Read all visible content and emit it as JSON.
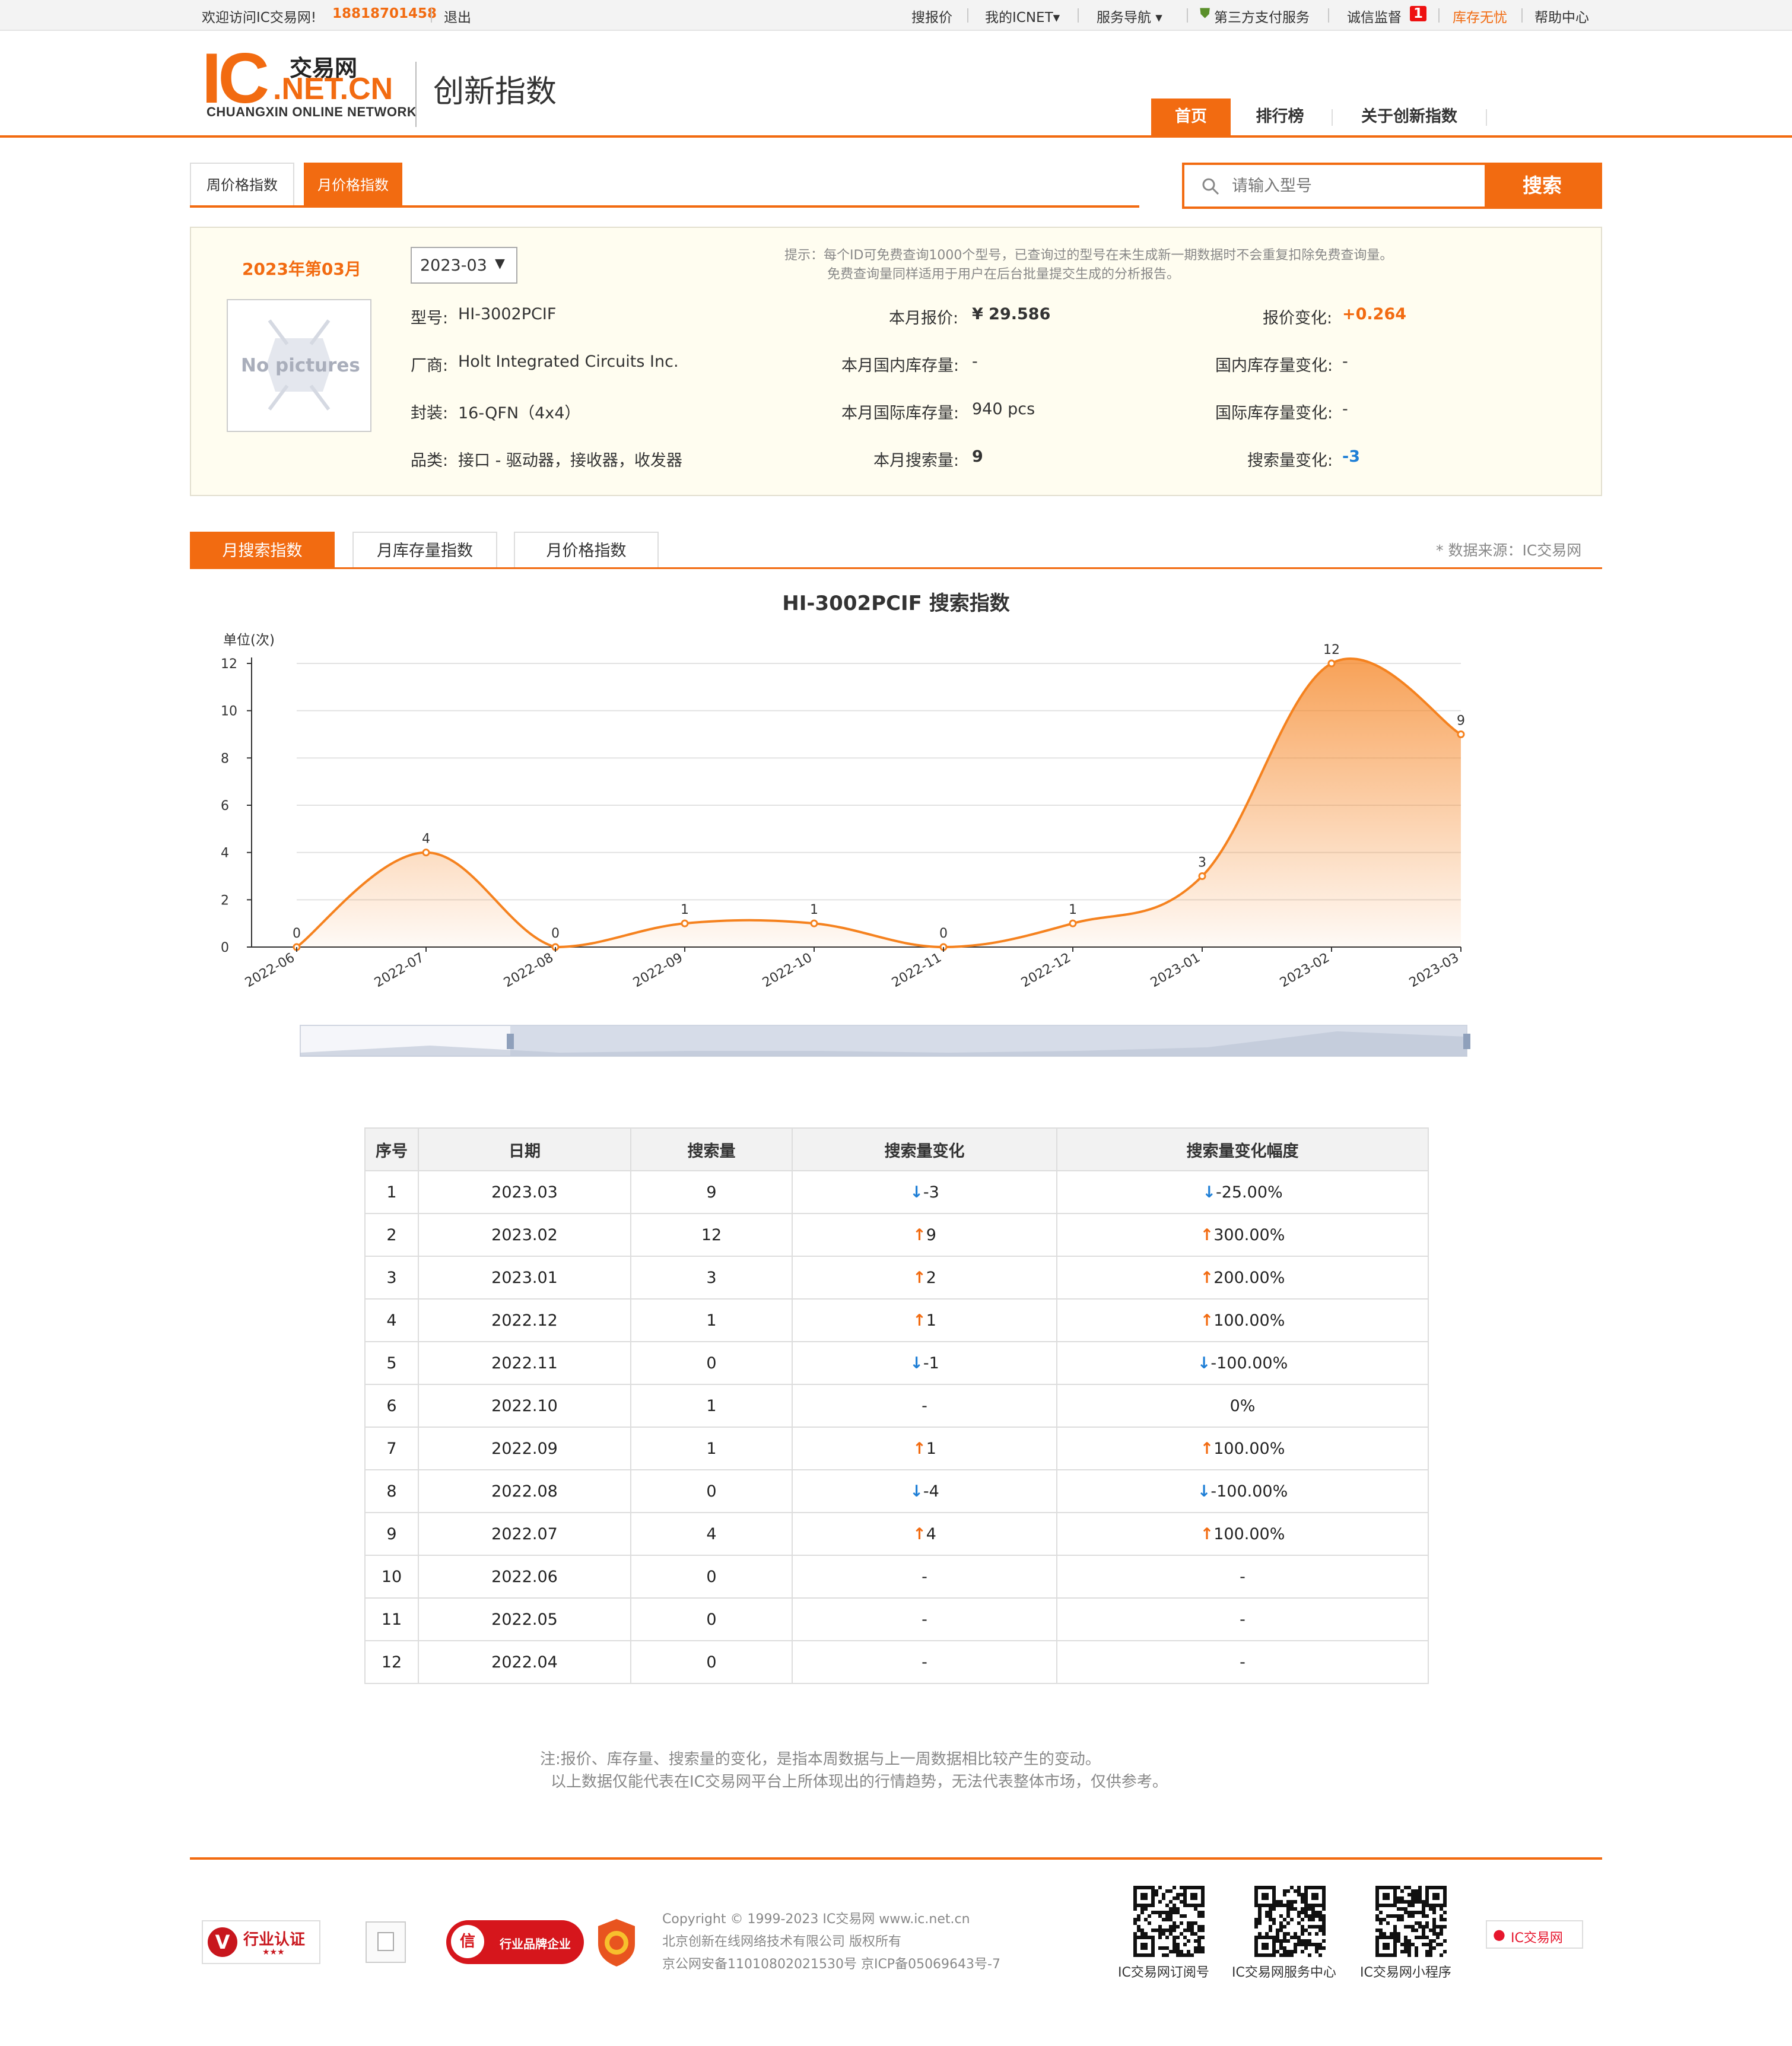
{
  "topbar": {
    "welcome": "欢迎访问IC交易网!",
    "phone": "18818701458",
    "logout": "退出",
    "links": [
      "搜报价",
      "我的ICNET▾",
      "服务导航 ▾",
      "第三方支付服务",
      "诚信监督",
      "库存无忧",
      "帮助中心"
    ],
    "badge": "1"
  },
  "header": {
    "logo_ic": "IC",
    "logo_cn": "交易网",
    "logo_net": ".NET.CN",
    "logo_en": "CHUANGXIN ONLINE NETWORK",
    "title": "创新指数",
    "nav": [
      "首页",
      "排行榜",
      "关于创新指数"
    ]
  },
  "subtabs": [
    "周价格指数",
    "月价格指数"
  ],
  "search": {
    "placeholder": "请输入型号",
    "button": "搜索"
  },
  "info": {
    "period": "2023年第03月",
    "select_value": "2023-03",
    "no_pic": "No pictures",
    "tip_line1": "提示：每个ID可免费查询1000个型号，已查询过的型号在未生成新一期数据时不会重复扣除免费查询量。",
    "tip_line2": "免费查询量同样适用于用户在后台批量提交生成的分析报告。",
    "model_label": "型号:",
    "model": "HI-3002PCIF",
    "maker_label": "厂商:",
    "maker": "Holt Integrated Circuits Inc.",
    "package_label": "封装:",
    "package": "16-QFN（4x4）",
    "category_label": "品类:",
    "category": "接口 - 驱动器，接收器，收发器",
    "price_label": "本月报价:",
    "price": "¥ 29.586",
    "domestic_label": "本月国内库存量:",
    "domestic": "-",
    "intl_label": "本月国际库存量:",
    "intl": "940   pcs",
    "searches_label": "本月搜索量:",
    "searches": "9",
    "price_change_label": "报价变化:",
    "price_change": "+0.264",
    "domestic_change_label": "国内库存量变化:",
    "domestic_change": "-",
    "intl_change_label": "国际库存量变化:",
    "intl_change": "-",
    "search_change_label": "搜索量变化:",
    "search_change": "-3"
  },
  "index_tabs": [
    "月搜索指数",
    "月库存量指数",
    "月价格指数"
  ],
  "source": "* 数据来源：IC交易网",
  "chart_data": {
    "type": "area",
    "title": "HI-3002PCIF 搜索指数",
    "ylabel": "单位(次)",
    "categories": [
      "2022-06",
      "2022-07",
      "2022-08",
      "2022-09",
      "2022-10",
      "2022-11",
      "2022-12",
      "2023-01",
      "2023-02",
      "2023-03"
    ],
    "values": [
      0,
      4,
      0,
      1,
      1,
      0,
      1,
      3,
      12,
      9
    ],
    "yticks": [
      0,
      2,
      4,
      6,
      8,
      10,
      12
    ],
    "ylim": [
      0,
      12
    ],
    "grid": true,
    "color": "#f5821f"
  },
  "table": {
    "headers": [
      "序号",
      "日期",
      "搜索量",
      "搜索量变化",
      "搜索量变化幅度"
    ],
    "rows": [
      [
        "1",
        "2023.03",
        "9",
        "-3",
        "-25.00%",
        "down"
      ],
      [
        "2",
        "2023.02",
        "12",
        "9",
        "300.00%",
        "up"
      ],
      [
        "3",
        "2023.01",
        "3",
        "2",
        "200.00%",
        "up"
      ],
      [
        "4",
        "2022.12",
        "1",
        "1",
        "100.00%",
        "up"
      ],
      [
        "5",
        "2022.11",
        "0",
        "-1",
        "-100.00%",
        "down"
      ],
      [
        "6",
        "2022.10",
        "1",
        "-",
        "0%",
        "none"
      ],
      [
        "7",
        "2022.09",
        "1",
        "1",
        "100.00%",
        "up"
      ],
      [
        "8",
        "2022.08",
        "0",
        "-4",
        "-100.00%",
        "down"
      ],
      [
        "9",
        "2022.07",
        "4",
        "4",
        "100.00%",
        "up"
      ],
      [
        "10",
        "2022.06",
        "0",
        "-",
        "-",
        "none"
      ],
      [
        "11",
        "2022.05",
        "0",
        "-",
        "-",
        "none"
      ],
      [
        "12",
        "2022.04",
        "0",
        "-",
        "-",
        "none"
      ]
    ]
  },
  "note": {
    "line1": "注:报价、库存量、搜索量的变化，是指本周数据与上一周数据相比较产生的变动。",
    "line2": "以上数据仅能代表在IC交易网平台上所体现出的行情趋势，无法代表整体市场，仅供参考。"
  },
  "footer": {
    "badge1": "行业认证",
    "badge3": "行业品牌企业",
    "copyright": "Copyright © 1999-2023 IC交易网 www.ic.net.cn",
    "company": "北京创新在线网络技术有限公司 版权所有",
    "icp": "京公网安备11010802021530号   京ICP备05069643号-7",
    "qr_labels": [
      "IC交易网订阅号",
      "IC交易网服务中心",
      "IC交易网小程序"
    ],
    "weibo": "IC交易网"
  }
}
